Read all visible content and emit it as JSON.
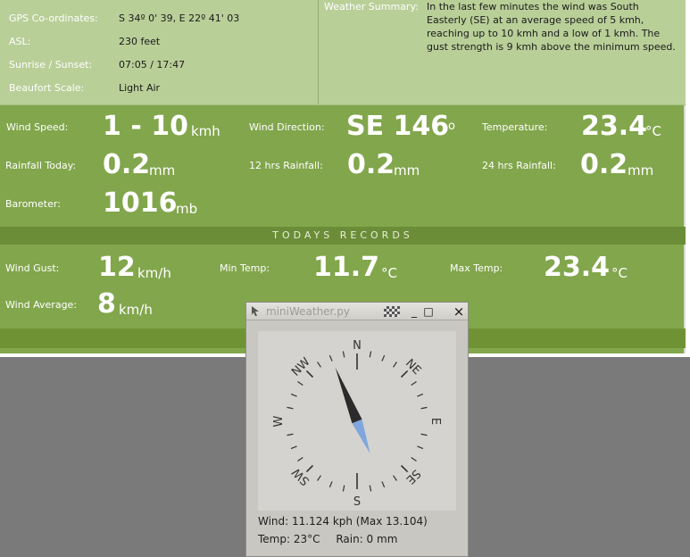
{
  "info": {
    "gps_label": "GPS Co-ordinates:",
    "gps_value": "S 34º 0' 39, E 22º 41' 03",
    "asl_label": "ASL:",
    "asl_value": "230 feet",
    "sun_label": "Sunrise / Sunset:",
    "sun_value": "07:05 / 17:47",
    "beaufort_label": "Beaufort Scale:",
    "beaufort_value": "Light Air",
    "summary_label": "Weather Summary:",
    "summary_text": "In the last few minutes the wind was South Easterly (SE) at an average speed of 5 kmh, reaching up to 10 kmh and a low of 1 kmh. The gust strength is 9 kmh above the minimum speed."
  },
  "current": {
    "wind_speed_label": "Wind Speed:",
    "wind_speed_value": "1 - 10",
    "wind_speed_unit": "kmh",
    "wind_dir_label": "Wind Direction:",
    "wind_dir_value": "SE 146",
    "wind_dir_unit": "o",
    "temp_label": "Temperature:",
    "temp_value": "23.4",
    "temp_unit": "°C",
    "rain_today_label": "Rainfall Today:",
    "rain_today_value": "0.2",
    "rain_today_unit": "mm",
    "rain12_label": "12 hrs Rainfall:",
    "rain12_value": "0.2",
    "rain12_unit": "mm",
    "rain24_label": "24 hrs Rainfall:",
    "rain24_value": "0.2",
    "rain24_unit": "mm",
    "baro_label": "Barometer:",
    "baro_value": "1016",
    "baro_unit": "mb"
  },
  "records": {
    "header": "TODAYS RECORDS",
    "gust_label": "Wind Gust:",
    "gust_value": "12",
    "gust_unit": "km/h",
    "min_temp_label": "Min Temp:",
    "min_temp_value": "11.7",
    "min_temp_unit": "°C",
    "max_temp_label": "Max Temp:",
    "max_temp_value": "23.4",
    "max_temp_unit": "°C",
    "avg_label": "Wind Average:",
    "avg_value": "8",
    "avg_unit": "km/h"
  },
  "window": {
    "title": "miniWeather.py",
    "minimize": "_",
    "maximize": "□",
    "close": "×",
    "compass_labels": {
      "n": "N",
      "ne": "NE",
      "e": "E",
      "se": "SE",
      "s": "S",
      "sw": "SW",
      "w": "W",
      "nw": "NW"
    },
    "needle_heading_deg": 158,
    "wind_text": "Wind: 11.124 kph (Max 13.104)",
    "temp_text": "Temp: 23°C",
    "rain_text": "Rain: 0 mm"
  }
}
